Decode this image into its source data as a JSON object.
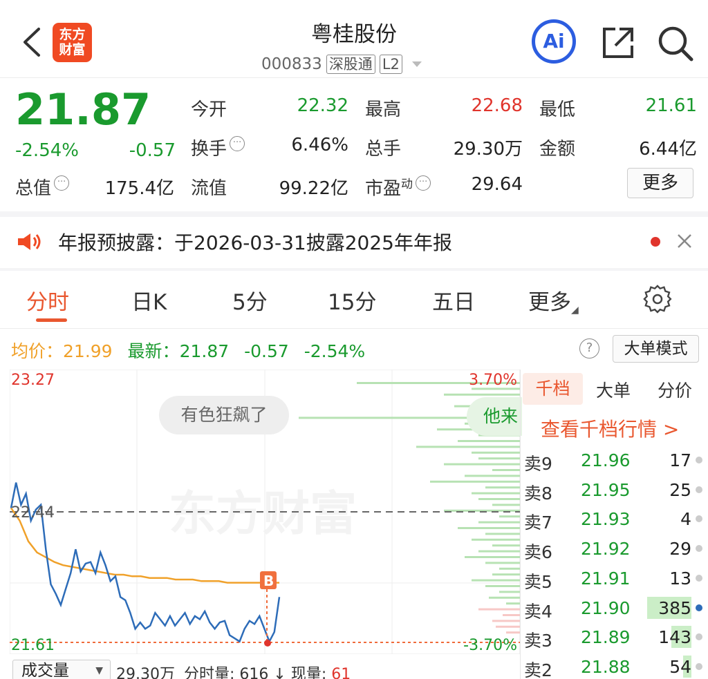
{
  "header": {
    "logo_lines": [
      "东方",
      "财富"
    ],
    "title": "粤桂股份",
    "code": "000833",
    "tag1": "深股通",
    "tag2": "L2",
    "ai_label": "Ai"
  },
  "quote": {
    "price": "21.87",
    "change_pct": "-2.54%",
    "change": "-0.57",
    "rows": [
      [
        {
          "label": "今开",
          "value": "22.32",
          "color": "green"
        },
        {
          "label": "最高",
          "value": "22.68",
          "color": "red"
        },
        {
          "label": "最低",
          "value": "21.61",
          "color": "green"
        }
      ],
      [
        {
          "label": "换手",
          "value": "6.46%",
          "color": "dark",
          "info": true
        },
        {
          "label": "总手",
          "value": "29.30万",
          "color": "dark"
        },
        {
          "label": "金额",
          "value": "6.44亿",
          "color": "dark"
        }
      ],
      [
        {
          "label": "流值",
          "value": "99.22亿",
          "color": "dark"
        },
        {
          "label": "市盈",
          "sup": "动",
          "value": "29.64",
          "color": "dark",
          "info": true
        }
      ]
    ],
    "total_value_label": "总值",
    "total_value": "175.4亿",
    "more_label": "更多"
  },
  "notice": {
    "text": "年报预披露：于2026-03-31披露2025年年报"
  },
  "tabs": [
    "分时",
    "日K",
    "5分",
    "15分",
    "五日",
    "更多"
  ],
  "avg_bar": {
    "avg_label": "均价：",
    "avg_value": "21.99",
    "latest_label": "最新：",
    "latest_value": "21.87",
    "change": "-0.57",
    "change_pct": "-2.54%",
    "big_order_btn": "大单模式"
  },
  "chart": {
    "y_top": "23.27",
    "y_mid": "22.44",
    "y_bottom": "21.61",
    "pct_top": "3.70%",
    "pct_bottom": "-3.70%",
    "bubble_text": "有色狂飙了",
    "bubble2_text": "他来",
    "watermark": "东方财富",
    "marker": "B"
  },
  "chart_data": {
    "type": "line",
    "ylim": [
      21.61,
      23.27
    ],
    "reference": 22.44,
    "series": [
      {
        "values": [
          22.46,
          22.62,
          22.48,
          22.55,
          22.38,
          22.45,
          22.48,
          22.2,
          21.98,
          21.92,
          21.85,
          21.95,
          22.05,
          22.2,
          22.06,
          22.11,
          22.12,
          22.05,
          22.18,
          22.1,
          22.0,
          22.03,
          21.9,
          21.88,
          21.8,
          21.7,
          21.74,
          21.7,
          21.72,
          21.8,
          21.76,
          21.72,
          21.78,
          21.72,
          21.76,
          21.8,
          21.73,
          21.78,
          21.76,
          21.81,
          21.74,
          21.7,
          21.74,
          21.75,
          21.66,
          21.64,
          21.62,
          21.7,
          21.75,
          21.73,
          21.78,
          21.7,
          21.62,
          21.68,
          21.9
        ]
      },
      {
        "values": [
          22.46,
          22.38,
          22.25,
          22.18,
          22.15,
          22.12,
          22.1,
          22.09,
          22.08,
          22.07,
          22.06,
          22.05,
          22.04,
          22.04,
          22.03,
          22.03,
          22.02,
          22.02,
          22.02,
          22.01,
          22.01,
          22.01,
          22.0,
          22.0,
          22.0,
          21.99,
          21.99,
          21.99,
          21.99,
          21.99,
          21.99,
          21.99
        ]
      }
    ]
  },
  "orderbook": {
    "tabs": [
      "千档",
      "大单",
      "分价"
    ],
    "link": "查看千档行情 >",
    "rows": [
      {
        "label": "卖9",
        "price": "21.96",
        "vol": "17",
        "bar": 0.0
      },
      {
        "label": "卖8",
        "price": "21.95",
        "vol": "25",
        "bar": 0.0
      },
      {
        "label": "卖7",
        "price": "21.93",
        "vol": "4",
        "bar": 0.0
      },
      {
        "label": "卖6",
        "price": "21.92",
        "vol": "29",
        "bar": 0.0
      },
      {
        "label": "卖5",
        "price": "21.91",
        "vol": "13",
        "bar": 0.0
      },
      {
        "label": "卖4",
        "price": "21.90",
        "vol": "385",
        "bar": 1.0,
        "blue": true
      },
      {
        "label": "卖3",
        "price": "21.89",
        "vol": "143",
        "bar": 0.45
      },
      {
        "label": "卖2",
        "price": "21.88",
        "vol": "54",
        "bar": 0.18
      }
    ]
  },
  "bottom": {
    "vol_selector": "成交量",
    "vol_total": "29.30万",
    "vol_minute_label": "分时量:",
    "vol_minute": "616",
    "vol_now_label": "现量:",
    "vol_now": "61"
  },
  "colors": {
    "up": "#e0342c",
    "down": "#1a9a2e",
    "avg": "#f0a12a",
    "accent": "#e9572f",
    "line": "#2d6cb8"
  }
}
